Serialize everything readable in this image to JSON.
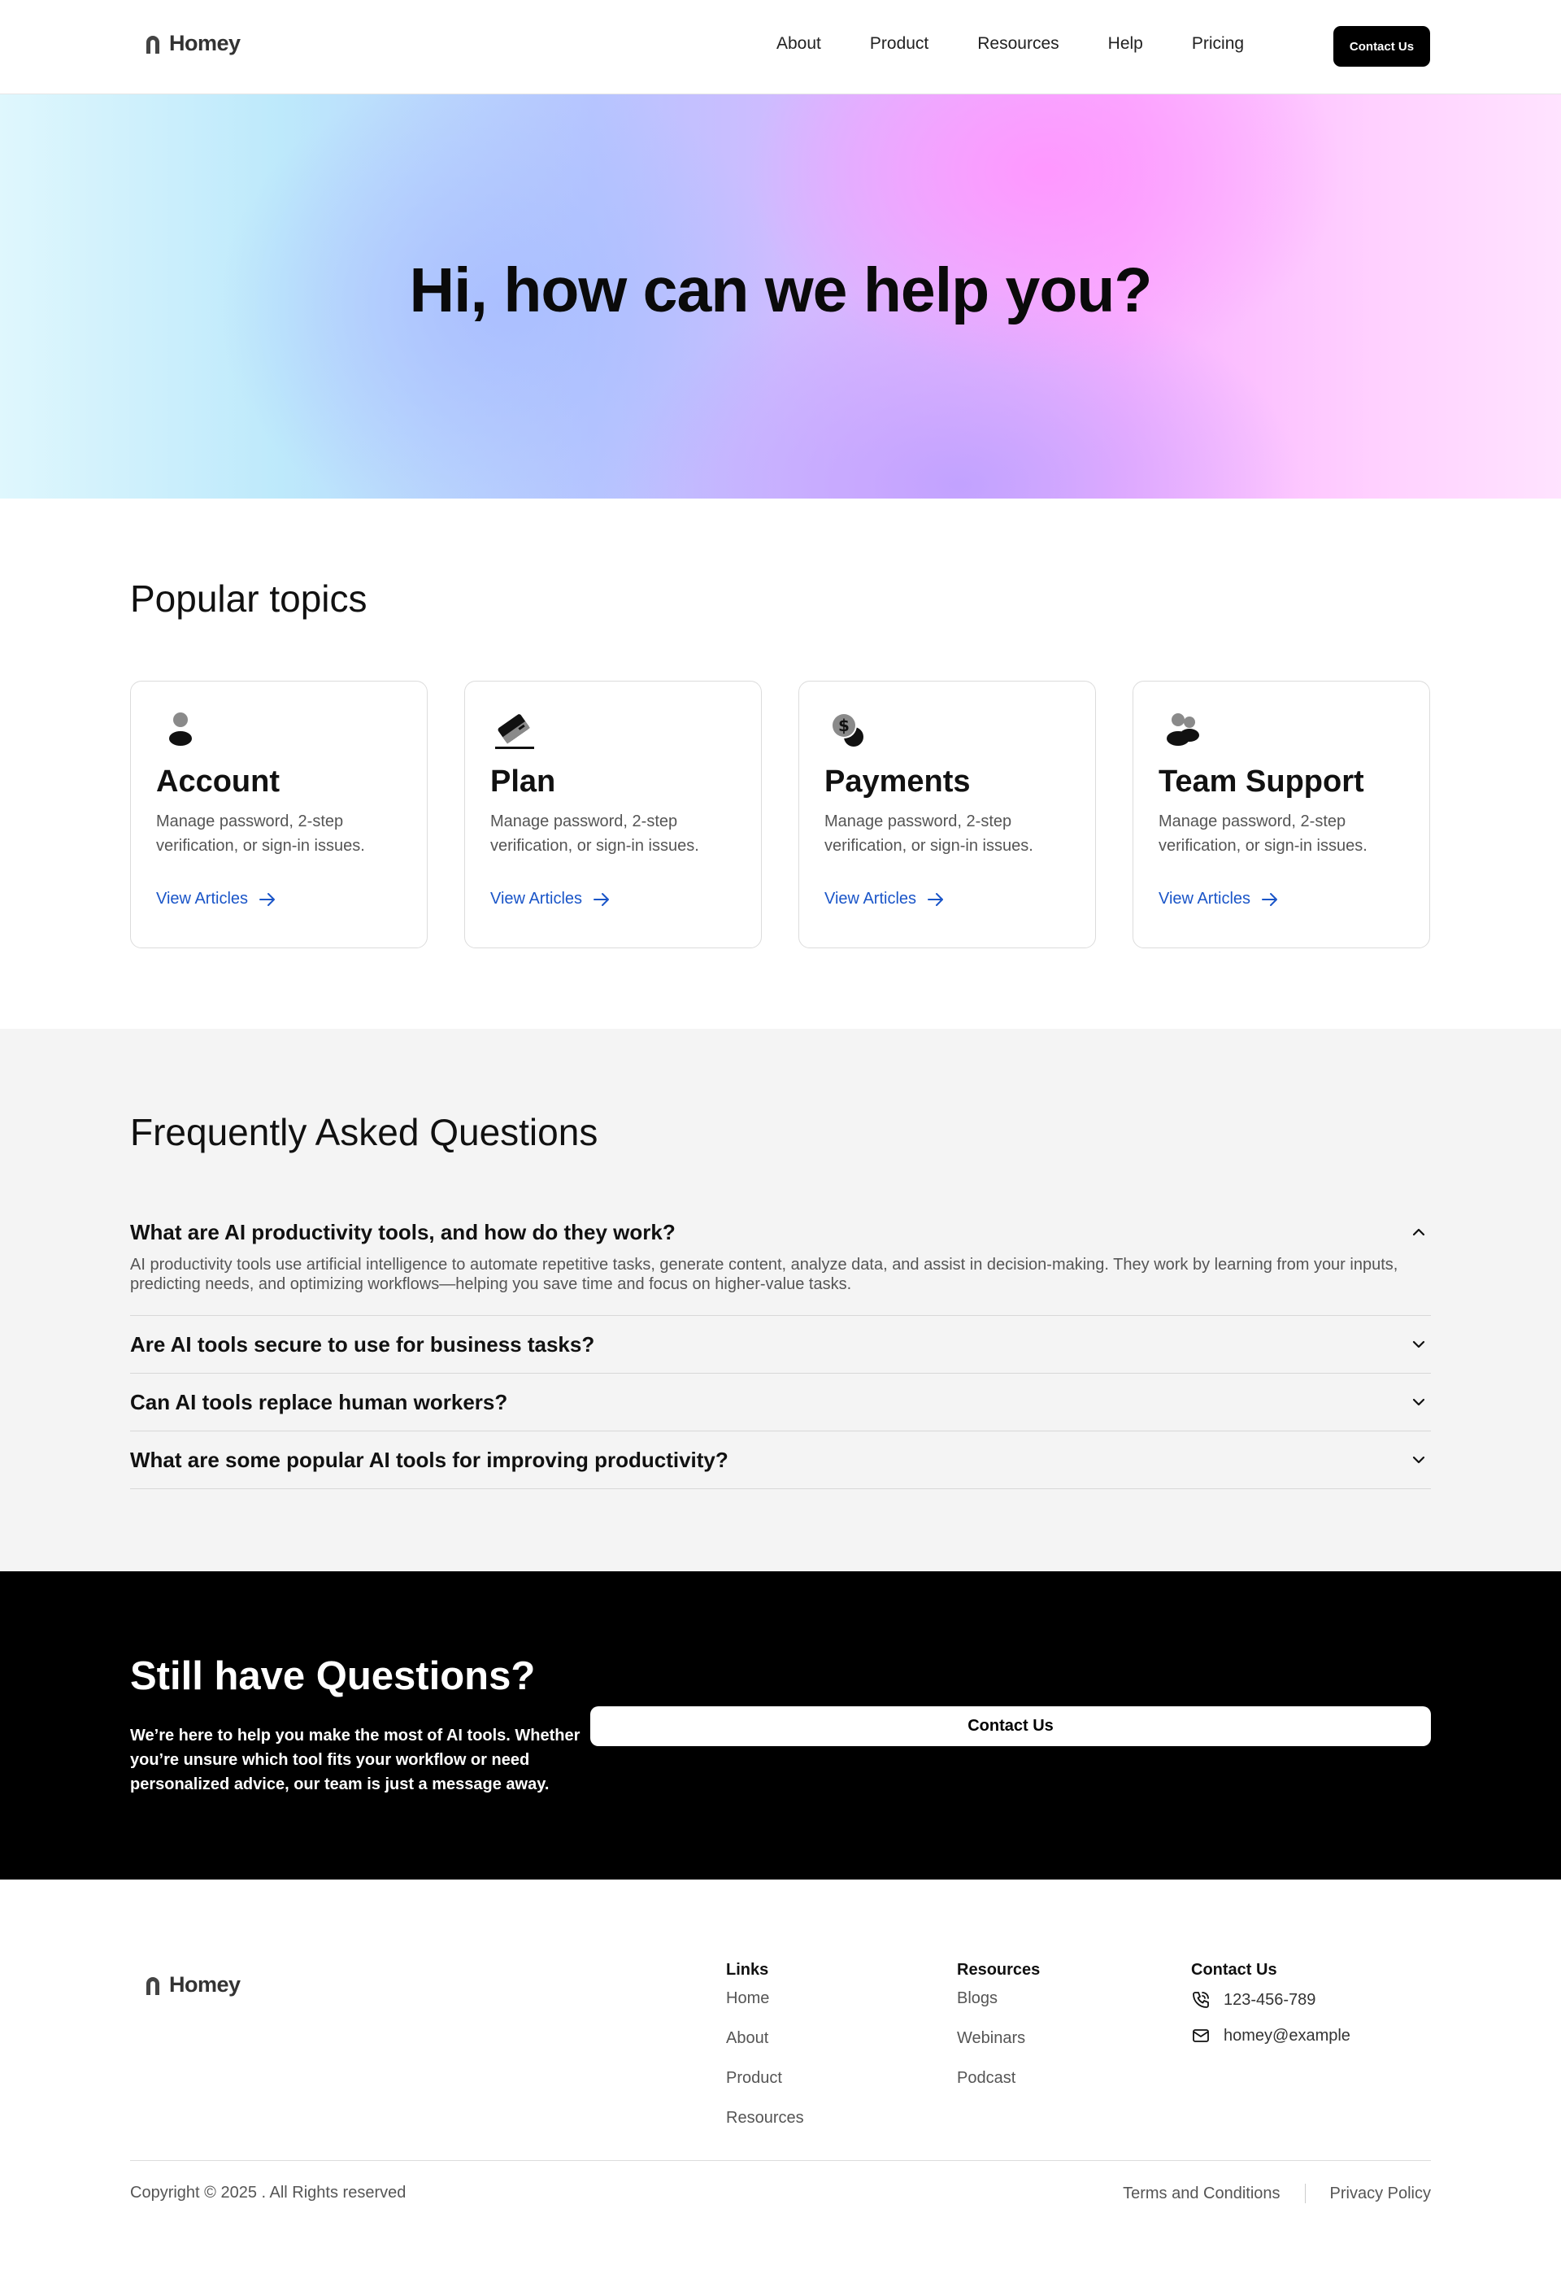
{
  "header": {
    "logo_text": "Homey",
    "nav": [
      "About",
      "Product",
      "Resources",
      "Help",
      "Pricing"
    ],
    "contact_label": "Contact Us"
  },
  "hero": {
    "title": "Hi, how can we help you?"
  },
  "topics": {
    "title": "Popular topics",
    "cards": [
      {
        "icon": "user-icon",
        "title": "Account",
        "desc": "Manage password, 2-step verification, or sign-in issues.",
        "link": "View Articles"
      },
      {
        "icon": "credit-card-icon",
        "title": "Plan",
        "desc": "Manage password, 2-step verification, or sign-in issues.",
        "link": "View Articles"
      },
      {
        "icon": "dollar-coins-icon",
        "title": "Payments",
        "desc": "Manage password, 2-step verification, or sign-in issues.",
        "link": "View Articles"
      },
      {
        "icon": "users-icon",
        "title": "Team Support",
        "desc": "Manage password, 2-step verification, or sign-in issues.",
        "link": "View Articles"
      }
    ]
  },
  "faq": {
    "title": "Frequently Asked Questions",
    "items": [
      {
        "q": "What are AI productivity tools, and how do they work?",
        "a": "AI productivity tools use artificial intelligence to automate repetitive tasks, generate content, analyze data, and assist in decision-making. They work by learning from your inputs, predicting needs, and optimizing workflows—helping you save time and focus on higher-value tasks.",
        "open": true
      },
      {
        "q": "Are AI tools secure to use for business tasks?",
        "open": false
      },
      {
        "q": "Can AI tools replace human workers?",
        "open": false
      },
      {
        "q": "What are some popular AI tools for improving productivity?",
        "open": false
      }
    ]
  },
  "cta": {
    "title": "Still have Questions?",
    "text": "We’re here to help you make the most of AI tools. Whether you’re unsure which tool fits your workflow or need personalized advice, our team is just a message away.",
    "button": "Contact Us"
  },
  "footer": {
    "logo_text": "Homey",
    "links": {
      "title": "Links",
      "items": [
        "Home",
        "About",
        "Product",
        "Resources"
      ]
    },
    "resources": {
      "title": "Resources",
      "items": [
        "Blogs",
        "Webinars",
        "Podcast"
      ]
    },
    "contact": {
      "title": "Contact Us",
      "phone": "123-456-789",
      "email": "homey@example"
    },
    "copyright": "Copyright © 2025 . All Rights reserved",
    "terms": "Terms and Conditions",
    "privacy": "Privacy Policy"
  },
  "colors": {
    "accent_link": "#1a55c8",
    "cta_bg": "#000000",
    "faq_bg": "#f4f4f4"
  }
}
